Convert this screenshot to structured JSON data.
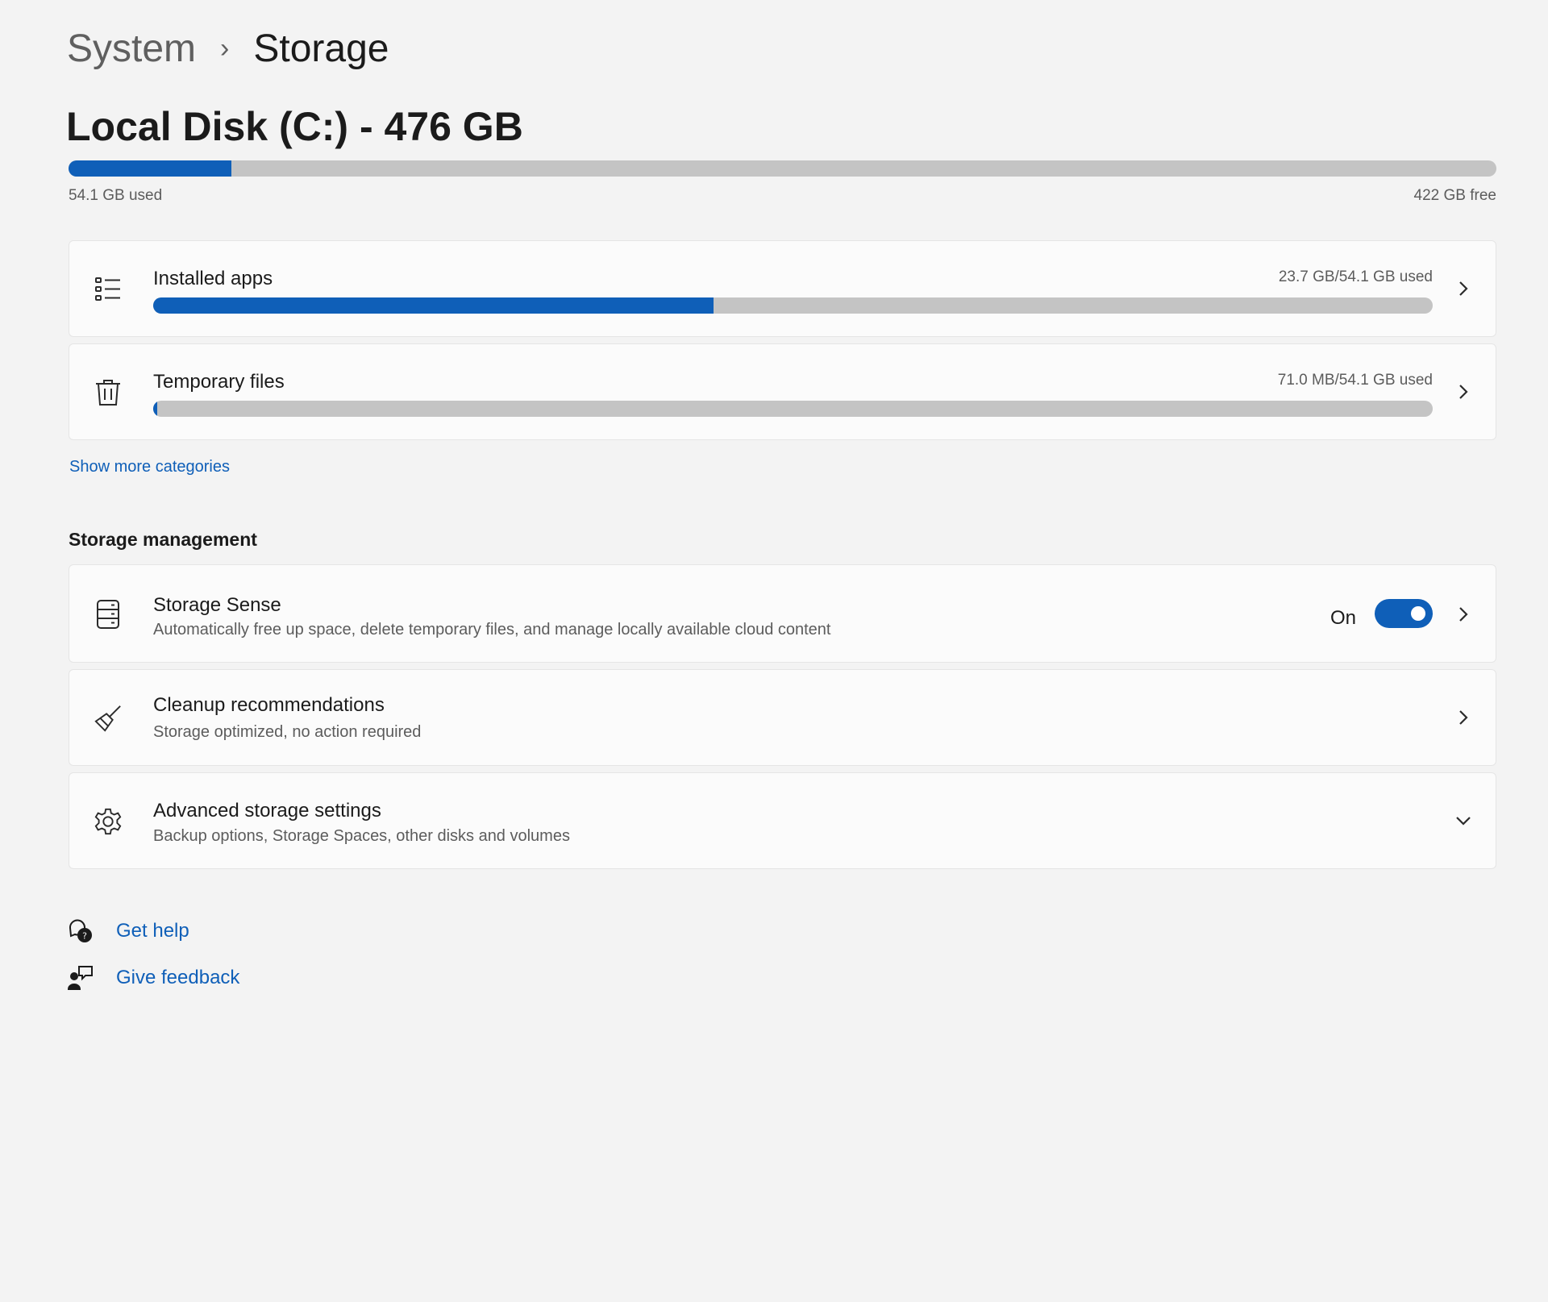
{
  "breadcrumb": {
    "parent": "System",
    "separator": "›",
    "current": "Storage"
  },
  "disk": {
    "title": "Local Disk (C:) - 476 GB",
    "used_label": "54.1 GB used",
    "free_label": "422 GB free",
    "used_fraction": 0.114,
    "bar_color": "#0f5fb8",
    "bar_track_color": "#c4c4c4"
  },
  "categories": [
    {
      "label": "Installed apps",
      "usage": "23.7 GB/54.1 GB used",
      "fraction": 0.438,
      "icon": "list-icon"
    },
    {
      "label": "Temporary files",
      "usage": "71.0 MB/54.1 GB used",
      "fraction": 0.0013,
      "icon": "trash-icon"
    }
  ],
  "show_more": "Show more categories",
  "management": {
    "heading": "Storage management",
    "storage_sense": {
      "title": "Storage Sense",
      "subtitle": "Automatically free up space, delete temporary files, and manage locally available cloud content",
      "toggle_label": "On",
      "toggle_on": true,
      "icon": "storage-drive-icon"
    },
    "cleanup": {
      "title": "Cleanup recommendations",
      "subtitle": "Storage optimized, no action required",
      "icon": "broom-icon"
    },
    "advanced": {
      "title": "Advanced storage settings",
      "subtitle": "Backup options, Storage Spaces, other disks and volumes",
      "icon": "gear-icon"
    }
  },
  "footer": {
    "get_help": "Get help",
    "give_feedback": "Give feedback"
  },
  "colors": {
    "accent": "#0f5fb8",
    "background": "#f3f3f3",
    "card": "#fbfbfb"
  }
}
